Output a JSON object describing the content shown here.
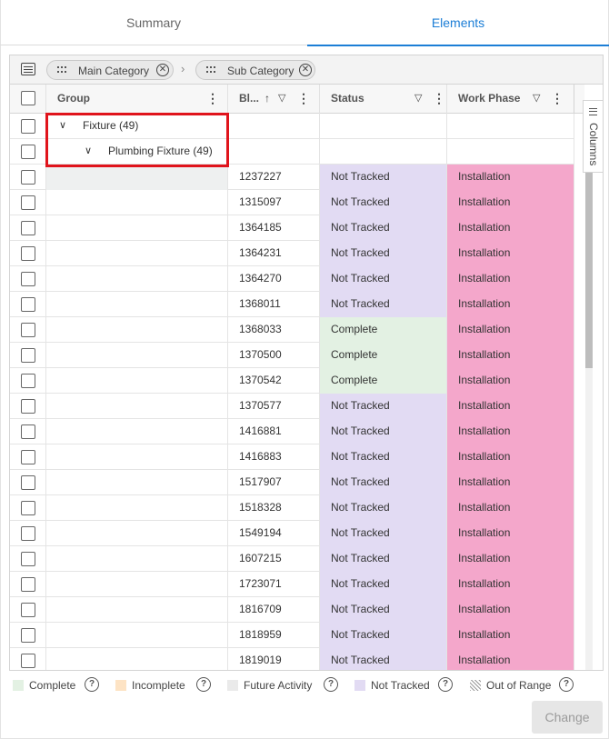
{
  "tabs": [
    {
      "label": "Summary"
    },
    {
      "label": "Elements"
    }
  ],
  "group_bar": {
    "chips": [
      {
        "label": "Main Category"
      },
      {
        "label": "Sub Category"
      }
    ]
  },
  "columns": {
    "group": "Group",
    "id": "Bl...",
    "status": "Status",
    "work_phase": "Work Phase"
  },
  "groups": [
    {
      "label": "Fixture (49)"
    },
    {
      "label": "Plumbing Fixture (49)"
    }
  ],
  "rows": [
    {
      "id": "1237227",
      "status": "Not Tracked",
      "phase": "Installation"
    },
    {
      "id": "1315097",
      "status": "Not Tracked",
      "phase": "Installation"
    },
    {
      "id": "1364185",
      "status": "Not Tracked",
      "phase": "Installation"
    },
    {
      "id": "1364231",
      "status": "Not Tracked",
      "phase": "Installation"
    },
    {
      "id": "1364270",
      "status": "Not Tracked",
      "phase": "Installation"
    },
    {
      "id": "1368011",
      "status": "Not Tracked",
      "phase": "Installation"
    },
    {
      "id": "1368033",
      "status": "Complete",
      "phase": "Installation"
    },
    {
      "id": "1370500",
      "status": "Complete",
      "phase": "Installation"
    },
    {
      "id": "1370542",
      "status": "Complete",
      "phase": "Installation"
    },
    {
      "id": "1370577",
      "status": "Not Tracked",
      "phase": "Installation"
    },
    {
      "id": "1416881",
      "status": "Not Tracked",
      "phase": "Installation"
    },
    {
      "id": "1416883",
      "status": "Not Tracked",
      "phase": "Installation"
    },
    {
      "id": "1517907",
      "status": "Not Tracked",
      "phase": "Installation"
    },
    {
      "id": "1518328",
      "status": "Not Tracked",
      "phase": "Installation"
    },
    {
      "id": "1549194",
      "status": "Not Tracked",
      "phase": "Installation"
    },
    {
      "id": "1607215",
      "status": "Not Tracked",
      "phase": "Installation"
    },
    {
      "id": "1723071",
      "status": "Not Tracked",
      "phase": "Installation"
    },
    {
      "id": "1816709",
      "status": "Not Tracked",
      "phase": "Installation"
    },
    {
      "id": "1818959",
      "status": "Not Tracked",
      "phase": "Installation"
    },
    {
      "id": "1819019",
      "status": "Not Tracked",
      "phase": "Installation"
    }
  ],
  "side_panel": {
    "label": "Columns"
  },
  "legend": [
    {
      "label": "Complete",
      "color": "#e3f1e3"
    },
    {
      "label": "Incomplete",
      "color": "#fde3c4"
    },
    {
      "label": "Future Activity",
      "color": "#eaeaea"
    },
    {
      "label": "Not Tracked",
      "color": "#e2dbf3"
    },
    {
      "label": "Out of Range",
      "color": "hatched"
    }
  ],
  "change_button": {
    "label": "Change"
  },
  "colors": {
    "accent": "#1c7ed6",
    "complete": "#e3f1e3",
    "not_tracked": "#e2dbf3",
    "installation": "#f4a7cb",
    "highlight": "#e0141c"
  }
}
